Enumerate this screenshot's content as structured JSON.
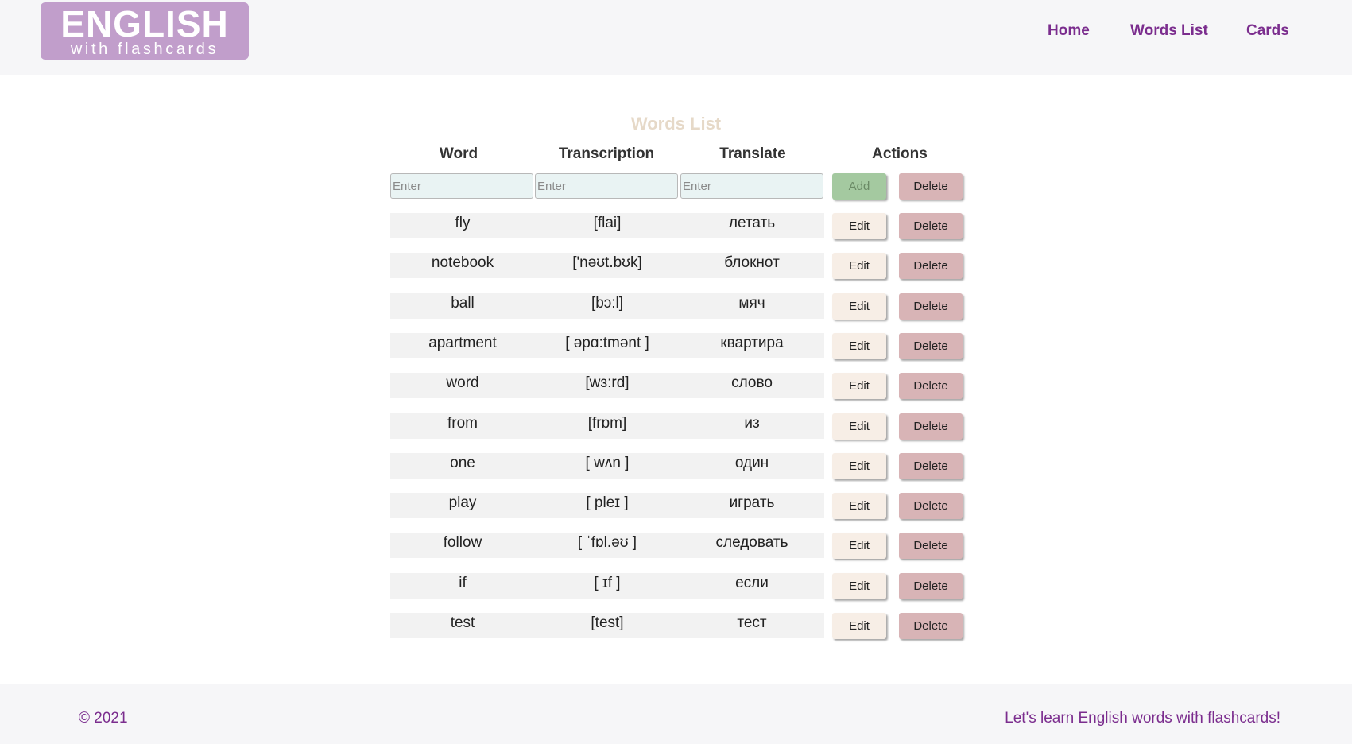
{
  "logo": {
    "title": "ENGLISH",
    "subtitle": "with flashcards"
  },
  "nav": {
    "home": "Home",
    "words_list": "Words List",
    "cards": "Cards"
  },
  "page_title": "Words List",
  "table": {
    "headers": {
      "word": "Word",
      "transcription": "Transcription",
      "translate": "Translate",
      "actions": "Actions"
    },
    "new_row": {
      "word_placeholder": "Enter",
      "transcription_placeholder": "Enter",
      "translate_placeholder": "Enter",
      "add_label": "Add",
      "delete_label": "Delete"
    },
    "edit_label": "Edit",
    "delete_label": "Delete",
    "rows": [
      {
        "word": "fly",
        "transcription": "[flai]",
        "translate": "летать"
      },
      {
        "word": "notebook",
        "transcription": "['nəʊt.bʊk]",
        "translate": "блокнот"
      },
      {
        "word": "ball",
        "transcription": "[bɔ:l]",
        "translate": "мяч"
      },
      {
        "word": "apartment",
        "transcription": "[ əpɑ:tmənt ]",
        "translate": "квартира"
      },
      {
        "word": "word",
        "transcription": "[wɜ:rd]",
        "translate": "слово"
      },
      {
        "word": "from",
        "transcription": "[frɒm]",
        "translate": "из"
      },
      {
        "word": "one",
        "transcription": "[ wʌn ]",
        "translate": "один"
      },
      {
        "word": "play",
        "transcription": "[ pleɪ ]",
        "translate": "играть"
      },
      {
        "word": "follow",
        "transcription": "[ ˈfɒl.əʊ ]",
        "translate": "следовать"
      },
      {
        "word": "if",
        "transcription": "[ ɪf ]",
        "translate": "если"
      },
      {
        "word": "test",
        "transcription": "[test]",
        "translate": "тест"
      }
    ]
  },
  "footer": {
    "copyright": "© 2021",
    "tagline": "Let's learn English words with flashcards!"
  },
  "colors": {
    "accent": "#7b2d8e",
    "logo_bg": "#c19ecb",
    "title": "#e6d9c8",
    "add_btn": "#a4c9a0",
    "edit_btn": "#f7eee6",
    "delete_btn": "#d8b4b6"
  }
}
